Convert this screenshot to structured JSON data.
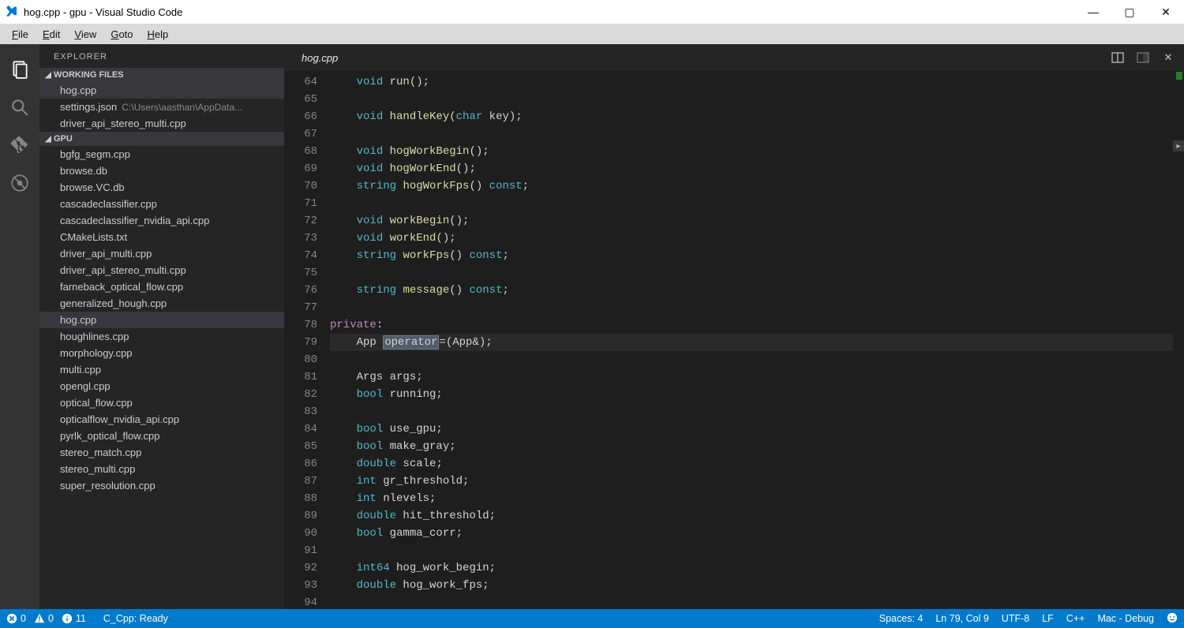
{
  "window": {
    "title": "hog.cpp - gpu - Visual Studio Code"
  },
  "menu": [
    "File",
    "Edit",
    "View",
    "Goto",
    "Help"
  ],
  "sidebar": {
    "title": "EXPLORER",
    "sections": {
      "working": {
        "label": "WORKING FILES",
        "items": [
          {
            "name": "hog.cpp",
            "active": true
          },
          {
            "name": "settings.json",
            "hint": "C:\\Users\\aasthan\\AppData..."
          },
          {
            "name": "driver_api_stereo_multi.cpp"
          }
        ]
      },
      "folder": {
        "label": "GPU",
        "items": [
          "bgfg_segm.cpp",
          "browse.db",
          "browse.VC.db",
          "cascadeclassifier.cpp",
          "cascadeclassifier_nvidia_api.cpp",
          "CMakeLists.txt",
          "driver_api_multi.cpp",
          "driver_api_stereo_multi.cpp",
          "farneback_optical_flow.cpp",
          "generalized_hough.cpp",
          "hog.cpp",
          "houghlines.cpp",
          "morphology.cpp",
          "multi.cpp",
          "opengl.cpp",
          "optical_flow.cpp",
          "opticalflow_nvidia_api.cpp",
          "pyrlk_optical_flow.cpp",
          "stereo_match.cpp",
          "stereo_multi.cpp",
          "super_resolution.cpp"
        ],
        "activeIndex": 10
      }
    }
  },
  "tab": {
    "name": "hog.cpp"
  },
  "code": {
    "start": 64,
    "currentLine": 79,
    "lines": [
      [
        [
          "    ",
          ""
        ],
        [
          "void",
          "k-type"
        ],
        [
          " ",
          ""
        ],
        [
          "run",
          "k-fn"
        ],
        [
          "();",
          "k-txt"
        ]
      ],
      [],
      [
        [
          "    ",
          ""
        ],
        [
          "void",
          "k-type"
        ],
        [
          " ",
          ""
        ],
        [
          "handleKey",
          "k-fn"
        ],
        [
          "(",
          "k-txt"
        ],
        [
          "char",
          "k-type"
        ],
        [
          " key);",
          "k-txt"
        ]
      ],
      [],
      [
        [
          "    ",
          ""
        ],
        [
          "void",
          "k-type"
        ],
        [
          " ",
          ""
        ],
        [
          "hogWorkBegin",
          "k-fn"
        ],
        [
          "();",
          "k-txt"
        ]
      ],
      [
        [
          "    ",
          ""
        ],
        [
          "void",
          "k-type"
        ],
        [
          " ",
          ""
        ],
        [
          "hogWorkEnd",
          "k-fn"
        ],
        [
          "();",
          "k-txt"
        ]
      ],
      [
        [
          "    ",
          ""
        ],
        [
          "string",
          "k-type"
        ],
        [
          " ",
          ""
        ],
        [
          "hogWorkFps",
          "k-fn"
        ],
        [
          "() ",
          "k-txt"
        ],
        [
          "const",
          "k-const"
        ],
        [
          ";",
          "k-txt"
        ]
      ],
      [],
      [
        [
          "    ",
          ""
        ],
        [
          "void",
          "k-type"
        ],
        [
          " ",
          ""
        ],
        [
          "workBegin",
          "k-fn"
        ],
        [
          "();",
          "k-txt"
        ]
      ],
      [
        [
          "    ",
          ""
        ],
        [
          "void",
          "k-type"
        ],
        [
          " ",
          ""
        ],
        [
          "workEnd",
          "k-fn"
        ],
        [
          "();",
          "k-txt"
        ]
      ],
      [
        [
          "    ",
          ""
        ],
        [
          "string",
          "k-type"
        ],
        [
          " ",
          ""
        ],
        [
          "workFps",
          "k-fn"
        ],
        [
          "() ",
          "k-txt"
        ],
        [
          "const",
          "k-const"
        ],
        [
          ";",
          "k-txt"
        ]
      ],
      [],
      [
        [
          "    ",
          ""
        ],
        [
          "string",
          "k-type"
        ],
        [
          " ",
          ""
        ],
        [
          "message",
          "k-fn"
        ],
        [
          "() ",
          "k-txt"
        ],
        [
          "const",
          "k-const"
        ],
        [
          ";",
          "k-txt"
        ]
      ],
      [],
      [
        [
          "private",
          "k-priv"
        ],
        [
          ":",
          "k-txt"
        ]
      ],
      [
        [
          "    App ",
          "k-txt"
        ],
        [
          "operator",
          "sel"
        ],
        [
          "=(App&);",
          "k-txt"
        ]
      ],
      [],
      [
        [
          "    Args args;",
          "k-txt"
        ]
      ],
      [
        [
          "    ",
          ""
        ],
        [
          "bool",
          "k-type"
        ],
        [
          " running;",
          "k-txt"
        ]
      ],
      [],
      [
        [
          "    ",
          ""
        ],
        [
          "bool",
          "k-type"
        ],
        [
          " use_gpu;",
          "k-txt"
        ]
      ],
      [
        [
          "    ",
          ""
        ],
        [
          "bool",
          "k-type"
        ],
        [
          " make_gray;",
          "k-txt"
        ]
      ],
      [
        [
          "    ",
          ""
        ],
        [
          "double",
          "k-type"
        ],
        [
          " scale;",
          "k-txt"
        ]
      ],
      [
        [
          "    ",
          ""
        ],
        [
          "int",
          "k-type"
        ],
        [
          " gr_threshold;",
          "k-txt"
        ]
      ],
      [
        [
          "    ",
          ""
        ],
        [
          "int",
          "k-type"
        ],
        [
          " nlevels;",
          "k-txt"
        ]
      ],
      [
        [
          "    ",
          ""
        ],
        [
          "double",
          "k-type"
        ],
        [
          " hit_threshold;",
          "k-txt"
        ]
      ],
      [
        [
          "    ",
          ""
        ],
        [
          "bool",
          "k-type"
        ],
        [
          " gamma_corr;",
          "k-txt"
        ]
      ],
      [],
      [
        [
          "    ",
          ""
        ],
        [
          "int64",
          "k-type"
        ],
        [
          " hog_work_begin;",
          "k-txt"
        ]
      ],
      [
        [
          "    ",
          ""
        ],
        [
          "double",
          "k-type"
        ],
        [
          " hog_work_fps;",
          "k-txt"
        ]
      ],
      []
    ]
  },
  "status": {
    "errors": "0",
    "warnings": "0",
    "info": "11",
    "lang_status": "C_Cpp: Ready",
    "spaces": "Spaces: 4",
    "pos": "Ln 79, Col 9",
    "encoding": "UTF-8",
    "eol": "LF",
    "lang": "C++",
    "config": "Mac - Debug"
  }
}
